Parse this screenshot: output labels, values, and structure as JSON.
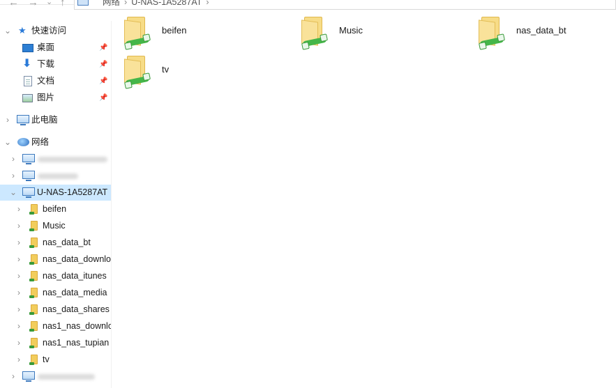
{
  "window": {
    "address_path": [
      "网络",
      "U-NAS-1A5287AT"
    ]
  },
  "nav": {
    "quick_access": {
      "label": "快速访问",
      "items": [
        {
          "label": "桌面",
          "icon": "desktop-icon",
          "pinned": true
        },
        {
          "label": "下载",
          "icon": "download-arrow-icon",
          "pinned": true
        },
        {
          "label": "文档",
          "icon": "document-icon",
          "pinned": true
        },
        {
          "label": "图片",
          "icon": "pictures-icon",
          "pinned": true
        }
      ]
    },
    "this_pc": {
      "label": "此电脑"
    },
    "network": {
      "label": "网络",
      "computers": [
        {
          "label": "DESKTOP-...",
          "redacted": true
        },
        {
          "label": "...",
          "redacted": true
        },
        {
          "label": "U-NAS-1A5287AT",
          "selected": true
        }
      ],
      "shares": [
        "beifen",
        "Music",
        "nas_data_bt",
        "nas_data_downlo",
        "nas_data_itunes",
        "nas_data_media",
        "nas_data_shares",
        "nas1_nas_downlo",
        "nas1_nas_tupian",
        "tv"
      ]
    }
  },
  "content": {
    "items": [
      "beifen",
      "Music",
      "nas_data_bt",
      "tv"
    ]
  },
  "colors": {
    "selection": "#cce8ff",
    "share_folder": "#f7dc87",
    "share_badge": "#45b649"
  }
}
